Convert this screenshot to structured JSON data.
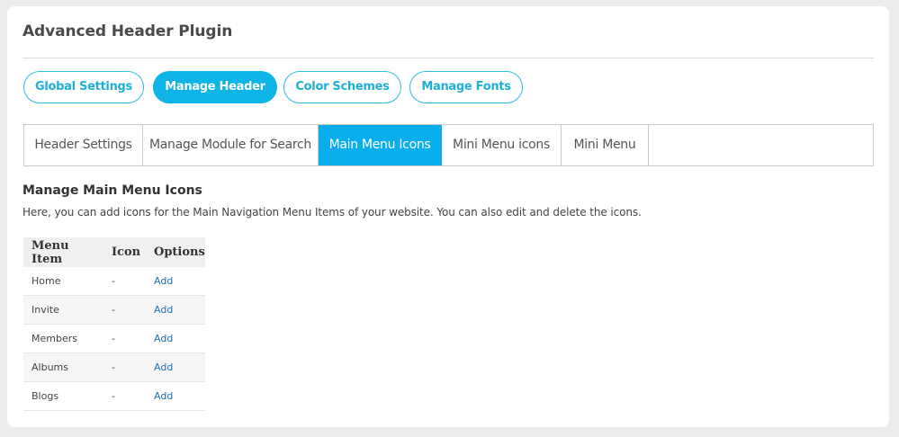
{
  "page": {
    "title": "Advanced Header Plugin"
  },
  "pills": [
    {
      "label": "Global Settings"
    },
    {
      "label": "Manage Header"
    },
    {
      "label": "Color Schemes"
    },
    {
      "label": "Manage Fonts"
    }
  ],
  "tabs": [
    {
      "label": "Header Settings"
    },
    {
      "label": "Manage Module for Search"
    },
    {
      "label": "Main Menu Icons"
    },
    {
      "label": "Mini Menu icons"
    },
    {
      "label": "Mini Menu"
    }
  ],
  "section": {
    "title": "Manage Main Menu Icons",
    "description": "Here, you can add icons for the Main Navigation Menu Items of your website. You can also edit and delete the icons."
  },
  "table": {
    "headers": [
      "Menu Item",
      "Icon",
      "Options"
    ],
    "rows": [
      {
        "item": "Home",
        "icon": "-",
        "option": "Add"
      },
      {
        "item": "Invite",
        "icon": "-",
        "option": "Add"
      },
      {
        "item": "Members",
        "icon": "-",
        "option": "Add"
      },
      {
        "item": "Albums",
        "icon": "-",
        "option": "Add"
      },
      {
        "item": "Blogs",
        "icon": "-",
        "option": "Add"
      }
    ]
  },
  "colors": {
    "accent": "#0fb4e7",
    "pill_border": "#2bbde0",
    "link": "#1a73b8"
  }
}
